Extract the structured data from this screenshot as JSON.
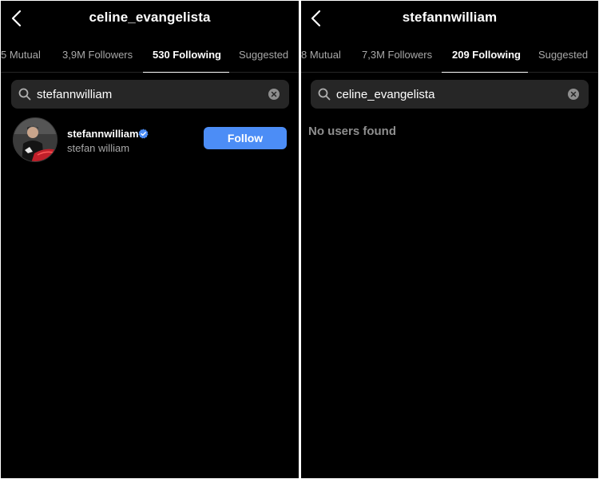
{
  "left": {
    "title": "celine_evangelista",
    "tabs": [
      {
        "label": "5 Mutual"
      },
      {
        "label": "3,9M Followers"
      },
      {
        "label": "530 Following"
      },
      {
        "label": "Suggested"
      }
    ],
    "active_tab": 2,
    "search": {
      "value": "stefannwilliam",
      "placeholder": "Search"
    },
    "result": {
      "username": "stefannwilliam",
      "full_name": "stefan william",
      "verified": true,
      "follow_label": "Follow"
    }
  },
  "right": {
    "title": "stefannwilliam",
    "tabs": [
      {
        "label": "8 Mutual"
      },
      {
        "label": "7,3M Followers"
      },
      {
        "label": "209 Following"
      },
      {
        "label": "Suggested"
      }
    ],
    "active_tab": 2,
    "search": {
      "value": "celine_evangelista",
      "placeholder": "Search"
    },
    "empty_message": "No users found"
  },
  "colors": {
    "background": "#000000",
    "search_bg": "#262626",
    "follow_button": "#4c8df6",
    "verified_badge": "#4c8df6",
    "muted_text": "#a8a8a8"
  }
}
